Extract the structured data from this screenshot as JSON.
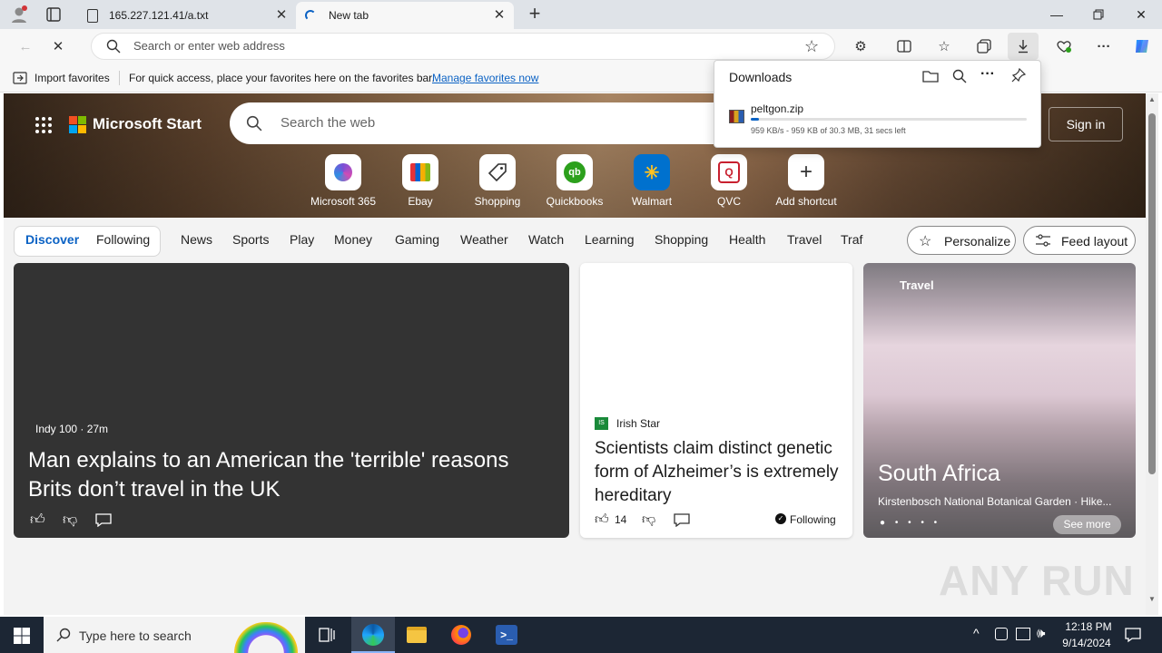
{
  "tabs": [
    {
      "title": "165.227.121.41/a.txt",
      "icon": "document-icon"
    },
    {
      "title": "New tab",
      "icon": "edge-loading-icon"
    }
  ],
  "address": {
    "placeholder": "Search or enter web address"
  },
  "favorites_bar": {
    "import_label": "Import favorites",
    "hint": "For quick access, place your favorites here on the favorites bar.",
    "manage_link": "Manage favorites now"
  },
  "downloads": {
    "title": "Downloads",
    "file_name": "peltgon.zip",
    "status": "959 KB/s - 959 KB of 30.3 MB, 31 secs left",
    "progress": 0.031
  },
  "header": {
    "brand": "Microsoft Start",
    "search_placeholder": "Search the web",
    "signin": "Sign in"
  },
  "shortcuts": [
    {
      "label": "Microsoft 365",
      "color": "#7b4fd6"
    },
    {
      "label": "Ebay",
      "color": "#e53238"
    },
    {
      "label": "Shopping",
      "color": "#333333"
    },
    {
      "label": "Quickbooks",
      "color": "#2ca01c"
    },
    {
      "label": "Walmart",
      "color": "#0071ce"
    },
    {
      "label": "QVC",
      "color": "#c8202f"
    },
    {
      "label": "Add shortcut",
      "color": "#555555"
    }
  ],
  "nav": {
    "discover": "Discover",
    "following": "Following",
    "items": [
      "News",
      "Sports",
      "Play",
      "Money",
      "Gaming",
      "Weather",
      "Watch",
      "Learning",
      "Shopping",
      "Health",
      "Travel",
      "Traf"
    ],
    "personalize": "Personalize",
    "feed_layout": "Feed layout"
  },
  "cards": {
    "main": {
      "source": "Indy 100 · 27m",
      "headline": "Man explains to an American the 'terrible' reasons Brits don’t travel in the UK"
    },
    "middle": {
      "source": "Irish Star",
      "headline": "Scientists claim distinct genetic form of Alzheimer’s is extremely hereditary",
      "likes": "14",
      "following": "Following"
    },
    "travel": {
      "tag": "Travel",
      "title": "South Africa",
      "subtitle": "Kirstenbosch National Botanical Garden · Hike...",
      "see_more": "See more"
    }
  },
  "watermark": "ANY RUN",
  "taskbar": {
    "search_placeholder": "Type here to search",
    "time": "12:18 PM",
    "date": "9/14/2024"
  }
}
